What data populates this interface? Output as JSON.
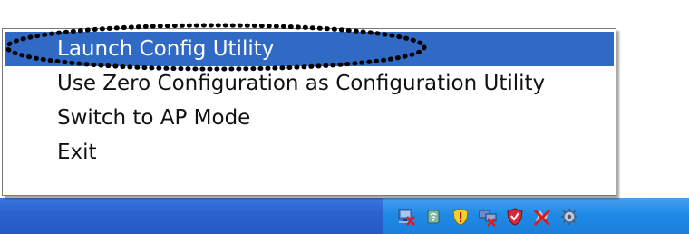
{
  "context_menu": {
    "items": [
      {
        "label": "Launch Config Utility",
        "selected": true
      },
      {
        "label": "Use Zero Configuration as Configuration Utility",
        "selected": false
      },
      {
        "label": "Switch to AP Mode",
        "selected": false
      },
      {
        "label": "Exit",
        "selected": false
      }
    ]
  },
  "tray": {
    "icons": [
      "network-disconnected-icon",
      "wireless-utility-icon",
      "security-shield-warning-icon",
      "network-error-icon",
      "antivirus-shield-icon",
      "red-x-disabled-icon",
      "settings-gear-icon"
    ]
  },
  "colors": {
    "menu_highlight": "#316ac5",
    "taskbar": "#2b63cf",
    "tray": "#1f8be6",
    "annotation": "#000000"
  }
}
